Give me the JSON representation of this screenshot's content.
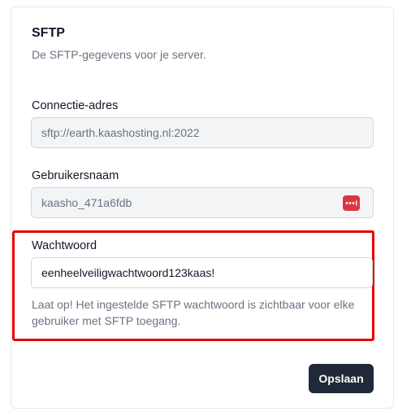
{
  "section": {
    "title": "SFTP",
    "subtitle": "De SFTP-gegevens voor je server."
  },
  "connection": {
    "label": "Connectie-adres",
    "value": "sftp://earth.kaashosting.nl:2022"
  },
  "username": {
    "label": "Gebruikersnaam",
    "value": "kaasho_471a6fdb",
    "icon": "password-manager-icon",
    "icon_color": "#dc3545"
  },
  "password": {
    "label": "Wachtwoord",
    "value": "eenheelveiligwachtwoord123kaas!",
    "hint": "Laat op! Het ingestelde SFTP wachtwoord is zichtbaar voor elke gebruiker met SFTP toegang.",
    "highlight_color": "#e10600"
  },
  "actions": {
    "save_label": "Opslaan"
  }
}
